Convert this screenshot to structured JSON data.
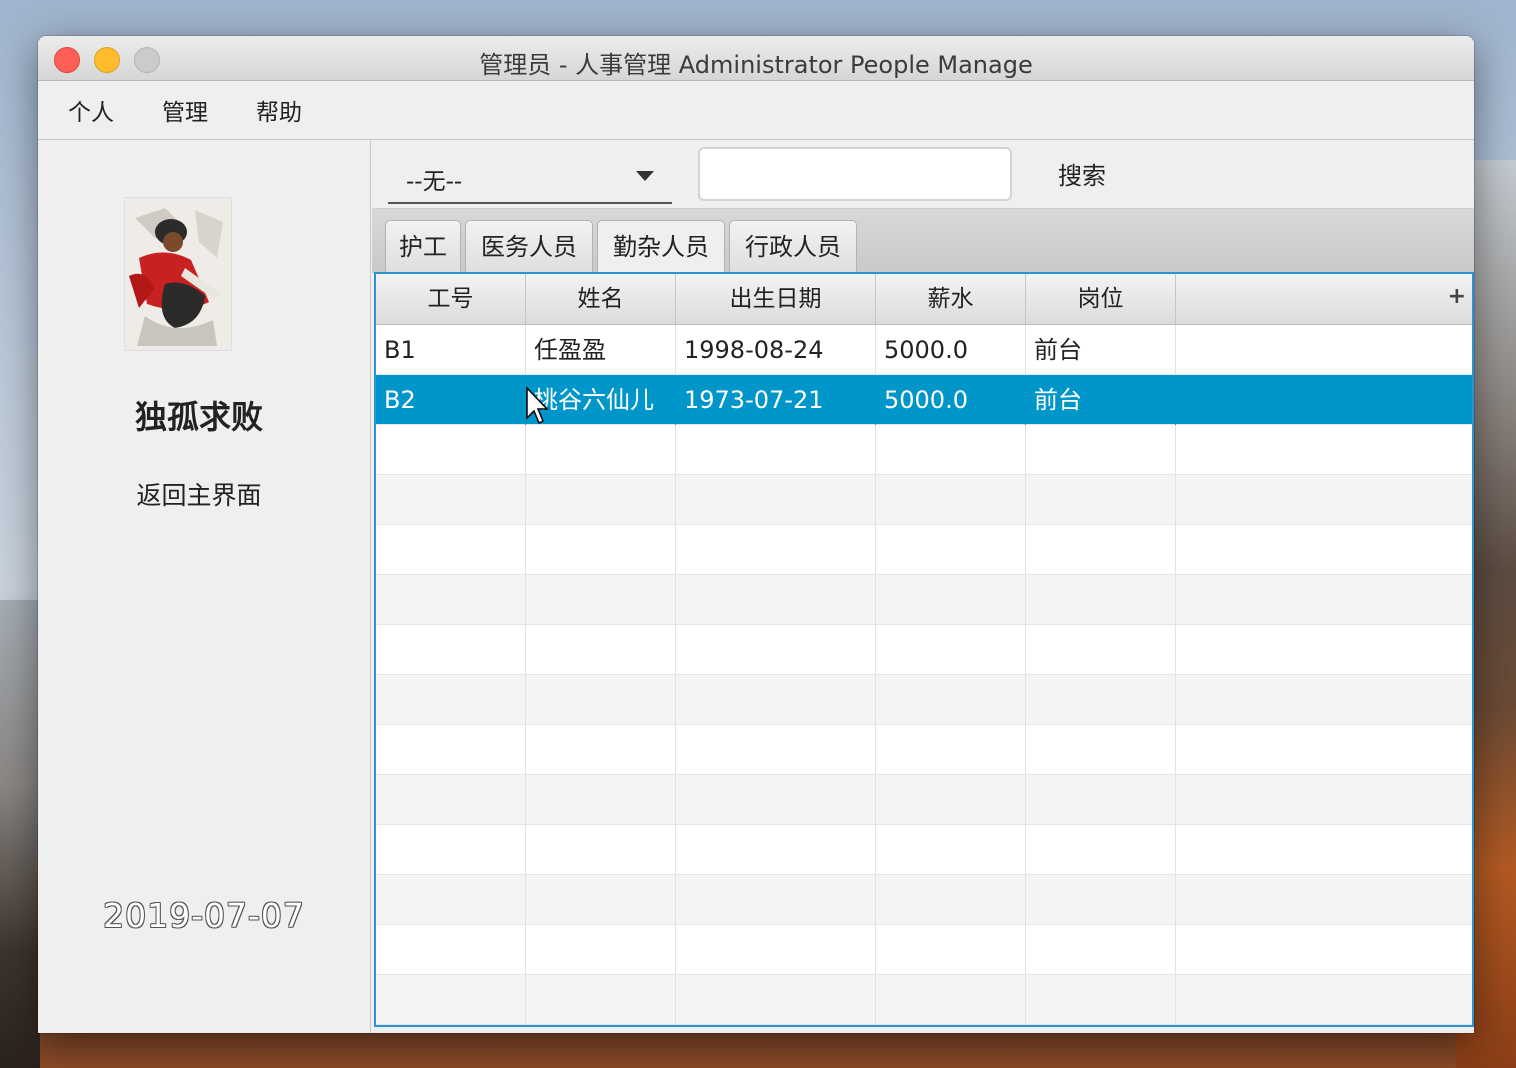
{
  "window": {
    "title": "管理员 - 人事管理 Administrator People Manage"
  },
  "menu": {
    "items": [
      "个人",
      "管理",
      "帮助"
    ]
  },
  "sidebar": {
    "username": "独孤求败",
    "back_label": "返回主界面",
    "date": "2019-07-07"
  },
  "toolbar": {
    "filter_value": "--无--",
    "search_value": "",
    "search_label": "搜索"
  },
  "tabs": [
    "护工",
    "医务人员",
    "勤杂人员",
    "行政人员"
  ],
  "active_tab": "勤杂人员",
  "table": {
    "columns": [
      "工号",
      "姓名",
      "出生日期",
      "薪水",
      "岗位"
    ],
    "add_column_icon": "plus-icon",
    "rows": [
      {
        "id": "B1",
        "name": "任盈盈",
        "birth": "1998-08-24",
        "salary": "5000.0",
        "position": "前台"
      },
      {
        "id": "B2",
        "name": "桃谷六仙儿",
        "birth": "1973-07-21",
        "salary": "5000.0",
        "position": "前台"
      }
    ],
    "selected_row": 1
  },
  "colors": {
    "selection": "#0096c9",
    "table_border": "#2b94cf"
  }
}
